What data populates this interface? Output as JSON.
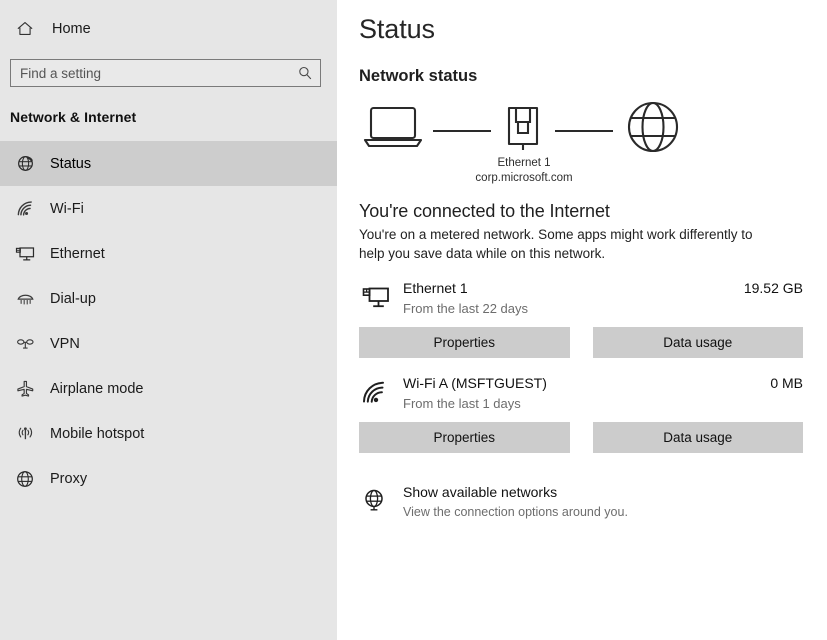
{
  "sidebar": {
    "home": {
      "label": "Home",
      "icon": "home-icon"
    },
    "search": {
      "placeholder": "Find a setting",
      "value": "",
      "icon": "search-icon"
    },
    "category_title": "Network & Internet",
    "items": [
      {
        "label": "Status",
        "icon": "status-globe-icon",
        "active": true
      },
      {
        "label": "Wi-Fi",
        "icon": "wifi-icon",
        "active": false
      },
      {
        "label": "Ethernet",
        "icon": "ethernet-icon",
        "active": false
      },
      {
        "label": "Dial-up",
        "icon": "dial-up-icon",
        "active": false
      },
      {
        "label": "VPN",
        "icon": "vpn-icon",
        "active": false
      },
      {
        "label": "Airplane mode",
        "icon": "airplane-icon",
        "active": false
      },
      {
        "label": "Mobile hotspot",
        "icon": "mobile-hotspot-icon",
        "active": false
      },
      {
        "label": "Proxy",
        "icon": "proxy-globe-icon",
        "active": false
      }
    ]
  },
  "main": {
    "page_title": "Status",
    "section_heading": "Network status",
    "diagram": {
      "device_icon": "laptop-icon",
      "adapter_icon": "ethernet-port-icon",
      "internet_icon": "globe-icon",
      "adapter_label": "Ethernet 1",
      "domain_label": "corp.microsoft.com"
    },
    "connection_status": {
      "title": "You're connected to the Internet",
      "description": "You're on a metered network. Some apps might work differently to help you save data while on this network."
    },
    "connections": [
      {
        "icon": "ethernet-monitor-icon",
        "name": "Ethernet 1",
        "subtitle": "From the last 22 days",
        "usage": "19.52 GB",
        "properties_label": "Properties",
        "data_usage_label": "Data usage"
      },
      {
        "icon": "wifi-icon",
        "name": "Wi-Fi A (MSFTGUEST)",
        "subtitle": "From the last 1 days",
        "usage": "0 MB",
        "properties_label": "Properties",
        "data_usage_label": "Data usage"
      }
    ],
    "footer_link": {
      "icon": "available-networks-globe-icon",
      "title": "Show available networks",
      "subtitle": "View the connection options around you."
    }
  },
  "colors": {
    "sidebar_bg": "#e6e6e6",
    "sidebar_active": "#cdcdcd",
    "button_bg": "#cccccc",
    "text_primary": "#111111",
    "text_secondary": "#6d6d6d"
  }
}
